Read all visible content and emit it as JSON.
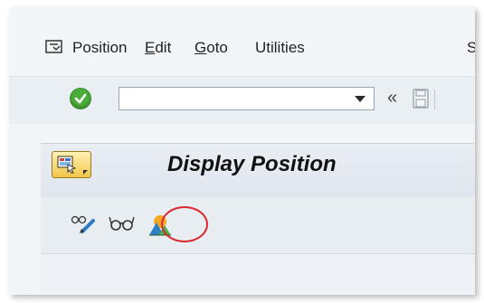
{
  "menubar": {
    "items": [
      {
        "label": "Position"
      },
      {
        "label": "Edit"
      },
      {
        "label": "Goto"
      },
      {
        "label": "Utilities"
      },
      {
        "label": "S"
      }
    ]
  },
  "toolbar": {
    "command_field_value": "",
    "nav_symbol": "«"
  },
  "title": {
    "text": "Display Position"
  },
  "app_toolbar": {
    "icons": [
      "change-icon",
      "display-icon",
      "overview-icon"
    ]
  },
  "colors": {
    "accent_green": "#4cae3a",
    "highlight_red": "#d9262b",
    "menu_button_yellow": "#f2c64a"
  }
}
